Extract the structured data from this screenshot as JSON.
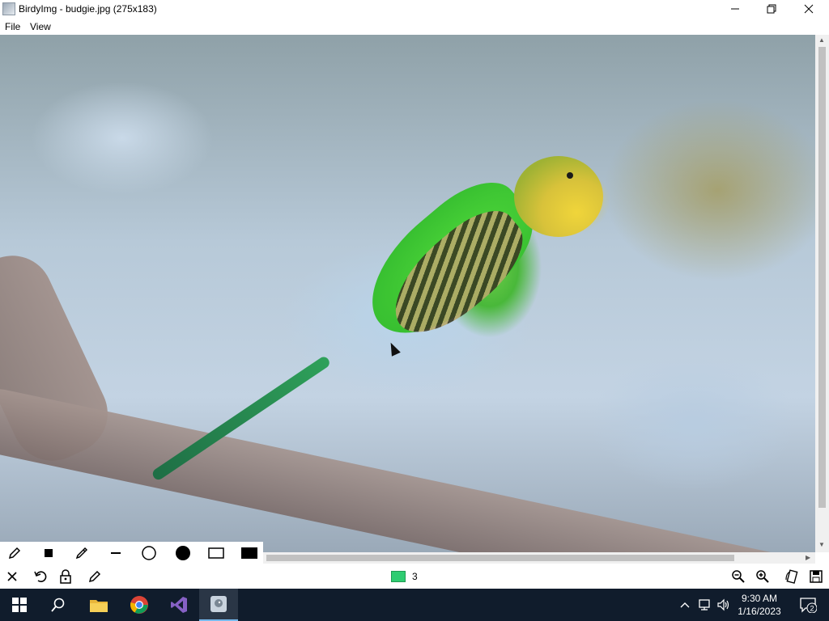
{
  "window": {
    "title": "BirdyImg - budgie.jpg (275x183)",
    "minimize": "—",
    "restore": "❐",
    "close": "✕"
  },
  "menu": [
    {
      "label": "File"
    },
    {
      "label": "View"
    }
  ],
  "image": {
    "description_icon": "budgie-photo"
  },
  "draw_tools": [
    {
      "name": "pencil-icon"
    },
    {
      "name": "filled-square-small-icon"
    },
    {
      "name": "eyedropper-icon"
    },
    {
      "name": "line-icon"
    },
    {
      "name": "circle-outline-icon"
    },
    {
      "name": "circle-filled-icon"
    },
    {
      "name": "rectangle-outline-icon"
    },
    {
      "name": "rectangle-filled-icon"
    }
  ],
  "status": {
    "color_swatch": "#2ecc71",
    "count": "3"
  },
  "bottom_tools": [
    {
      "name": "close-icon",
      "glyph": "✕"
    },
    {
      "name": "undo-icon",
      "glyph": "↶"
    },
    {
      "name": "lock-icon",
      "glyph": "🔒"
    },
    {
      "name": "edit-pencil-icon",
      "glyph": "✎"
    }
  ],
  "right_tools": [
    {
      "name": "zoom-out-icon"
    },
    {
      "name": "zoom-in-icon"
    },
    {
      "name": "rotate-icon"
    },
    {
      "name": "save-icon"
    }
  ],
  "taskbar": {
    "time": "9:30 AM",
    "date": "1/16/2023",
    "notification_count": "2"
  }
}
